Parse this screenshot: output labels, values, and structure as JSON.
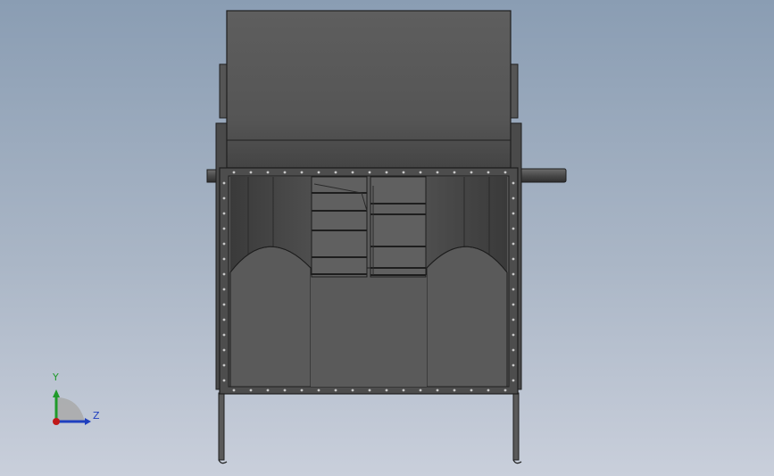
{
  "view": {
    "background_top": "#8a9db3",
    "background_bottom": "#c9cfdb",
    "model_name": "",
    "colors": {
      "body": "#5a5a5a",
      "body_dark": "#3e3e3e",
      "body_light": "#6c6c6c",
      "outline": "#1e1e1e",
      "bolt": "#c8c8c8"
    }
  },
  "triad": {
    "y_label": "Y",
    "z_label": "Z",
    "y_color": "#1f9a2a",
    "z_color": "#1f3fbf",
    "origin_color": "#c01818"
  }
}
